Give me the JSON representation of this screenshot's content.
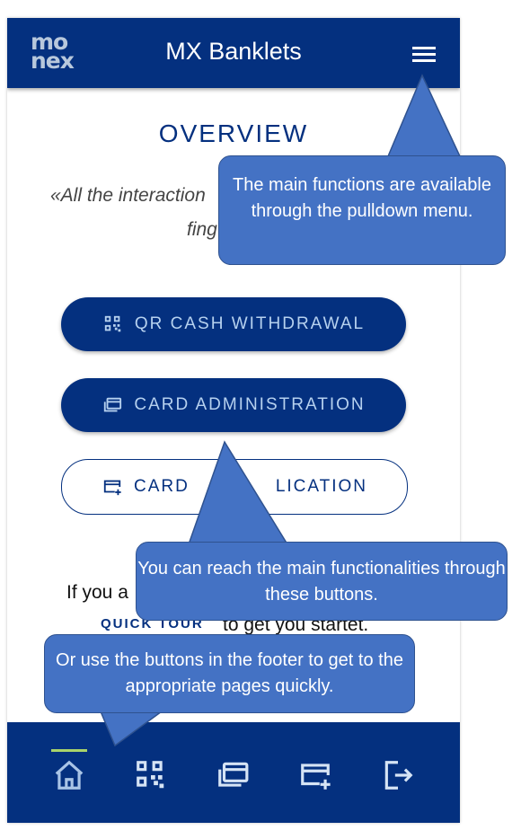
{
  "header": {
    "logo_line1": "mo",
    "logo_line2": "nex",
    "title": "MX Banklets",
    "menu_icon": "hamburger-menu-icon"
  },
  "main": {
    "heading": "OVERVIEW",
    "quote_line1": "«All the interaction",
    "quote_line2": "fing",
    "buttons": [
      {
        "label": "QR CASH WITHDRAWAL",
        "icon": "qr-code-icon",
        "style": "dark"
      },
      {
        "label": "CARD ADMINISTRATION",
        "icon": "cards-stack-icon",
        "style": "dark"
      },
      {
        "label": "CARD APPLICATION",
        "visible_part_1": "CARD",
        "visible_part_2": "LICATION",
        "icon": "card-add-icon",
        "style": "light"
      }
    ],
    "intro_line1": "If you a",
    "tour_link": "QUICK TOUR",
    "intro_line2": "to get you startet."
  },
  "footer": {
    "items": [
      {
        "name": "home",
        "icon": "home-icon",
        "active": true
      },
      {
        "name": "qr",
        "icon": "qr-code-icon"
      },
      {
        "name": "cards",
        "icon": "cards-stack-icon"
      },
      {
        "name": "card-add",
        "icon": "card-add-icon"
      },
      {
        "name": "logout",
        "icon": "logout-icon"
      }
    ],
    "active_color": "#a9d36a"
  },
  "callouts": {
    "menu": "The main functions are available through the pulldown menu.",
    "buttons": "You can reach the main functionalities through these buttons.",
    "footer": "Or use the buttons in the footer to get to the appropriate pages quickly."
  },
  "colors": {
    "brand_navy": "#04307f",
    "button_text": "#b6d1ef",
    "callout_blue": "#4472c4",
    "callout_border": "#2f528f"
  }
}
